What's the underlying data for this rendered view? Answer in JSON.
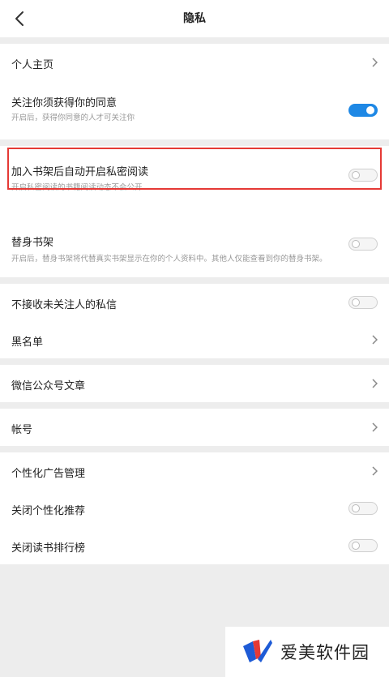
{
  "header": {
    "title": "隐私"
  },
  "settings": {
    "profile": {
      "label": "个人主页"
    },
    "follow_consent": {
      "label": "关注你须获得你的同意",
      "desc": "开启后，获得你同意的人才可关注你",
      "enabled": true
    },
    "private_reading": {
      "label": "加入书架后自动开启私密阅读",
      "desc": "开启私密阅读的书籍阅读动态不会公开",
      "enabled": false
    },
    "proxy_shelf": {
      "label": "替身书架",
      "desc": "开启后，替身书架将代替真实书架显示在你的个人资料中。其他人仅能查看到你的替身书架。",
      "enabled": false
    },
    "block_stranger_messages": {
      "label": "不接收未关注人的私信",
      "enabled": false
    },
    "blacklist": {
      "label": "黑名单"
    },
    "wechat_articles": {
      "label": "微信公众号文章"
    },
    "account": {
      "label": "帐号"
    },
    "ad_management": {
      "label": "个性化广告管理"
    },
    "disable_personalized_recs": {
      "label": "关闭个性化推荐",
      "enabled": false
    },
    "disable_reading_rank": {
      "label": "关闭读书排行榜",
      "enabled": false
    }
  },
  "watermark": {
    "text": "爱美软件园"
  },
  "colors": {
    "accent": "#1e88e5",
    "highlight": "#e53935"
  }
}
